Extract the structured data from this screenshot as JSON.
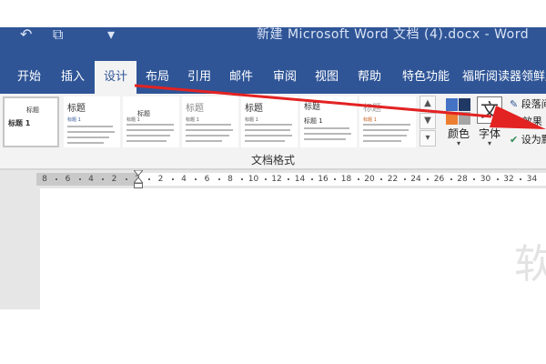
{
  "titlebar": {
    "doc_title": "新建 Microsoft Word 文档 (4).docx  -  Word",
    "qat": [
      "undo-icon",
      "print-preview-icon",
      "customize-arrow-icon"
    ]
  },
  "tabs": [
    "开始",
    "插入",
    "设计",
    "布局",
    "引用",
    "邮件",
    "审阅",
    "视图",
    "帮助",
    "特色功能",
    "福昕阅读器领鲜版"
  ],
  "active_tab": "设计",
  "styles": [
    {
      "title": "标题",
      "sub": "标题 1"
    },
    {
      "title": "标题",
      "sub": "标题 1"
    },
    {
      "title": "标题",
      "sub": "标题 1"
    },
    {
      "title": "标题",
      "sub": "标题 1"
    },
    {
      "title": "标题",
      "sub": "标题 1"
    },
    {
      "title": "标题",
      "sub": "标题 1"
    },
    {
      "title": "标题",
      "sub": "标题 1"
    }
  ],
  "colors_label": "颜色",
  "fonts_label": "字体",
  "fonts_glyph": "文",
  "side_commands": [
    "段落间",
    "效果",
    "设为默"
  ],
  "group_label": "文档格式",
  "ruler_numbers": [
    "8",
    "6",
    "4",
    "2",
    "2",
    "2",
    "4",
    "6",
    "8",
    "10",
    "12",
    "14",
    "16",
    "18",
    "20",
    "22",
    "24",
    "26",
    "28",
    "30",
    "32",
    "34",
    "36"
  ],
  "page_char": "软",
  "colors": {
    "brand": "#2f5597",
    "ribbon": "#f3f3f3",
    "annotation": "#e32222"
  }
}
